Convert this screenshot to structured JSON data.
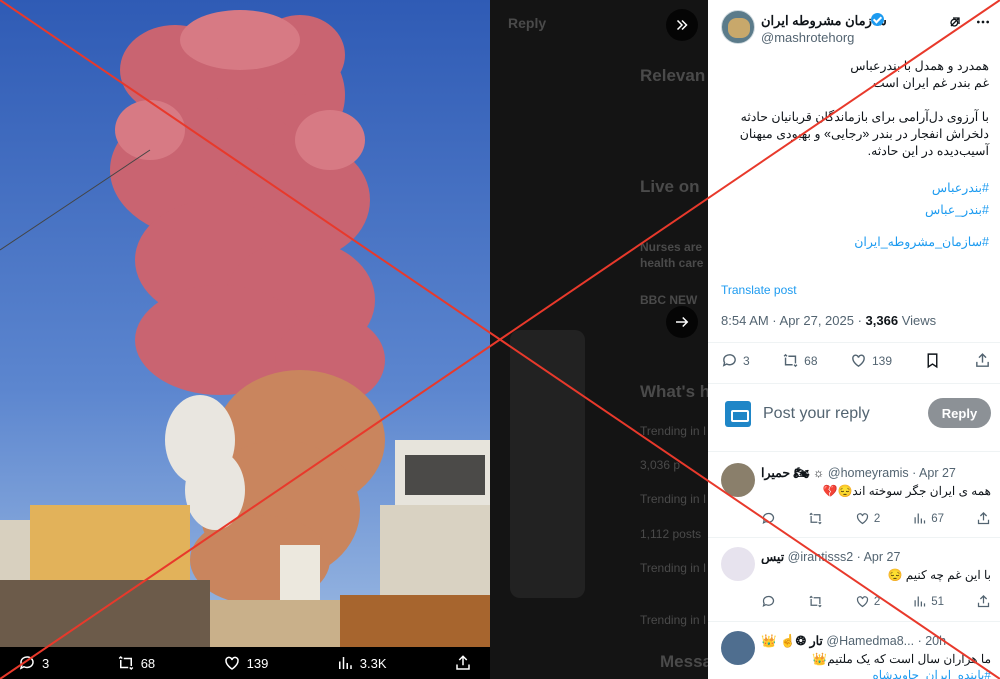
{
  "background": {
    "reply_label": "Reply",
    "relevant_heading": "Relevan",
    "live_heading": "Live on",
    "bbc_label": "BBC NEW",
    "whats_heading": "What's h",
    "messages_heading": "Messa",
    "trending_1": "Trending in I",
    "posts_1": "3,036 p",
    "trending_2": "Trending in I",
    "posts_2": "1,112 posts",
    "trending_3": "Trending in I",
    "trending_4": "Trending in I",
    "nurses": "Nurses are",
    "health": "health care"
  },
  "media_actions": {
    "replies": "3",
    "reposts": "68",
    "likes": "139",
    "views": "3.3K"
  },
  "post": {
    "display_name": "سازمان مشروطه ایران",
    "handle": "@mashrotehorg",
    "lines": [
      "همدرد و همدل با بندرعباس",
      "غم بندر غم ایران است",
      "",
      "با آرزوی دل‌آرامی برای بازماندگان قربانیان حادثه",
      "دلخراش انفجار در بندر «رجایی» و بهبودی میهنان",
      "آسیب‌دیده در این حادثه.",
      ""
    ],
    "hashtags": [
      "#بندرعباس",
      "#بندر_عباس",
      "",
      "#سازمان_مشروطه_ایران"
    ],
    "translate_label": "Translate post",
    "timestamp": "8:54 AM · Apr 27, 2025 · ",
    "views_count": "3,366",
    "views_label": " Views",
    "replies": "3",
    "reposts": "68",
    "likes": "139"
  },
  "composer": {
    "placeholder": "Post your reply",
    "button_label": "Reply"
  },
  "comments": [
    {
      "name": "حمیرا 🏍 ☼",
      "handle": "@homeyramis · Apr 27",
      "text": "همه ی ایران جگر سوخته اند😔💔",
      "reposts": "",
      "likes": "2",
      "views": "67"
    },
    {
      "name": "تیس",
      "handle": "@irantisss2 · Apr 27",
      "text": "با این غم چه کنیم 😔",
      "reposts": "",
      "likes": "2",
      "views": "51"
    },
    {
      "name": "👑 ☝️❂ تار",
      "handle": "@Hamedma8... · 20h",
      "text": "ما هزاران سال است که یک ملتیم👑",
      "text2": "#پاینده_ایران_جاویدشاه"
    }
  ],
  "colors": {
    "accent": "#1d9bf0",
    "cross": "#e8392b"
  }
}
